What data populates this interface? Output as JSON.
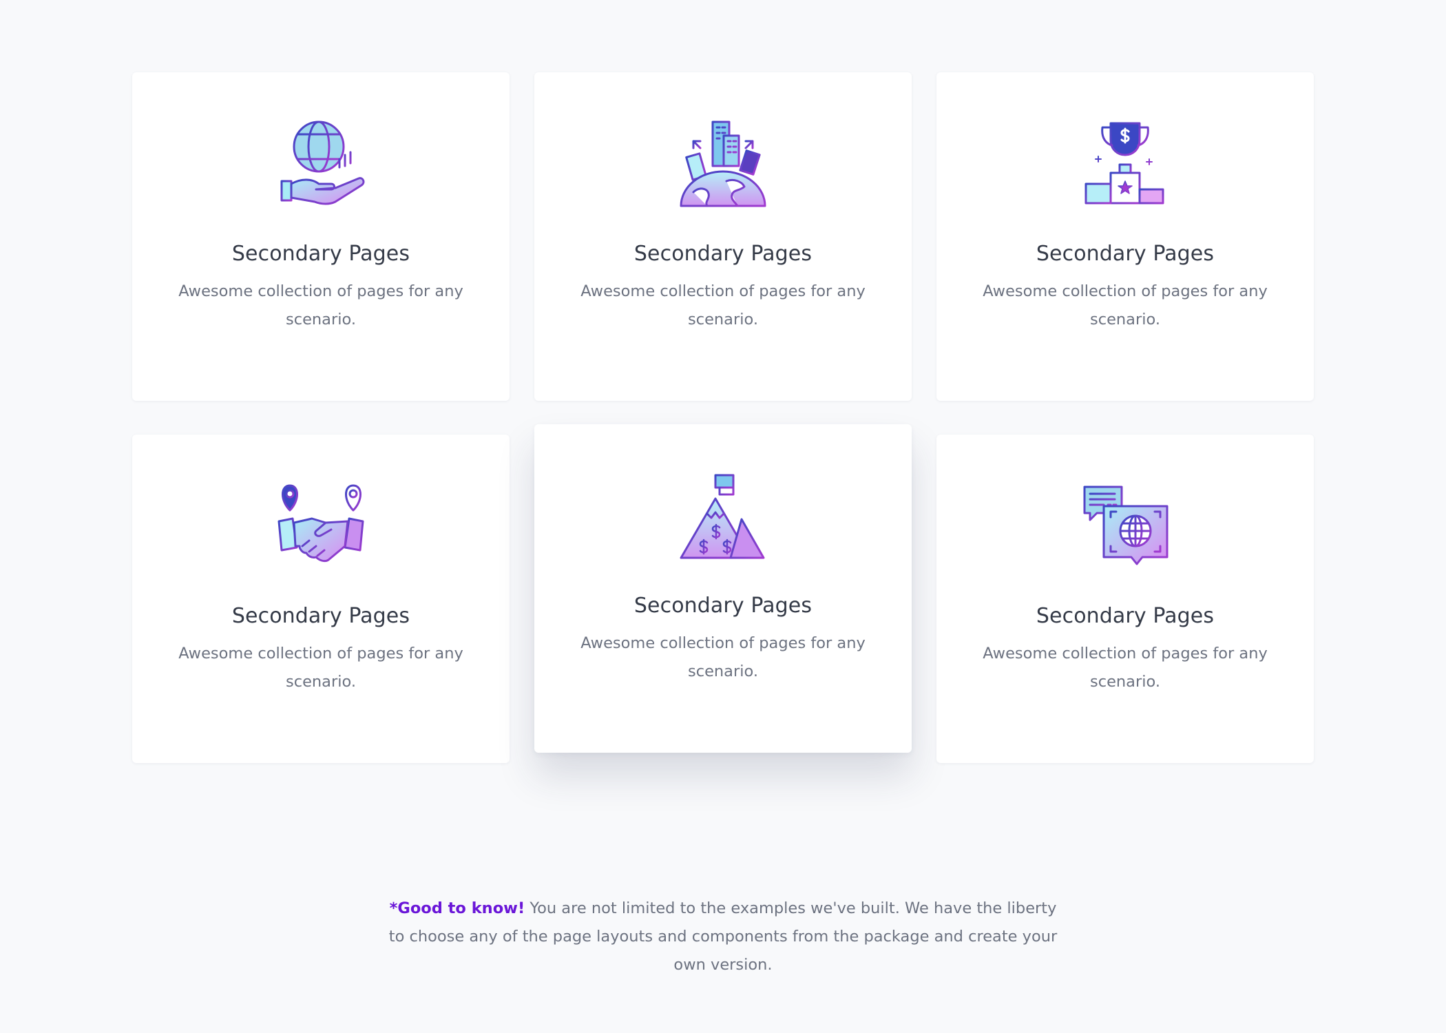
{
  "colors": {
    "background": "#f8f9fb",
    "card": "#ffffff",
    "title": "#343a47",
    "text": "#6c7280",
    "accent_purple": "#6a16d8",
    "icon_stroke": "#3d3aa4"
  },
  "cards": [
    {
      "icon": "globe-in-hand-icon",
      "title": "Secondary Pages",
      "text": "Awesome collection of pages for any scenario."
    },
    {
      "icon": "city-on-globe-icon",
      "title": "Secondary Pages",
      "text": "Awesome collection of pages for any scenario."
    },
    {
      "icon": "trophy-podium-icon",
      "title": "Secondary Pages",
      "text": "Awesome collection of pages for any scenario."
    },
    {
      "icon": "handshake-location-icon",
      "title": "Secondary Pages",
      "text": "Awesome collection of pages for any scenario."
    },
    {
      "icon": "mountain-flag-icon",
      "title": "Secondary Pages",
      "text": "Awesome collection of pages for any scenario."
    },
    {
      "icon": "chat-globe-icon",
      "title": "Secondary Pages",
      "text": "Awesome collection of pages for any scenario."
    }
  ],
  "note": {
    "highlight": "*Good to know!",
    "text": " You are not limited to the examples we've built. We have the liberty to choose any of the page layouts and components from the package and create your own version."
  }
}
